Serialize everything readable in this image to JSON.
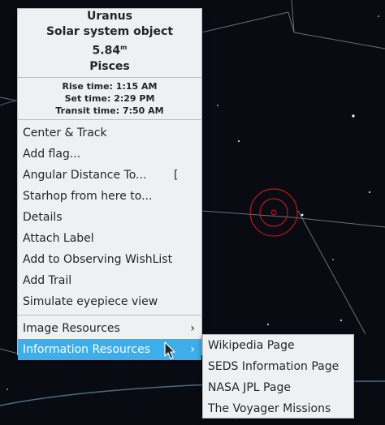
{
  "object": {
    "name": "Uranus",
    "type": "Solar system object",
    "magnitude": "5.84",
    "magnitude_unit": "m",
    "constellation": "Pisces",
    "rise": "Rise time: 1:15 AM",
    "set": "Set time: 2:29 PM",
    "transit": "Transit time: 7:50 AM"
  },
  "menu": {
    "center_track": "Center & Track",
    "add_flag": "Add flag...",
    "angular_distance": "Angular Distance To...",
    "angular_distance_shortcut": "[",
    "starhop": "Starhop from here to...",
    "details": "Details",
    "attach_label": "Attach Label",
    "add_wishlist": "Add to Observing WishList",
    "add_trail": "Add Trail",
    "simulate_eyepiece": "Simulate eyepiece view",
    "image_resources": "Image Resources",
    "information_resources": "Information Resources"
  },
  "submenu": {
    "wikipedia": "Wikipedia Page",
    "seds": "SEDS Information Page",
    "nasa_jpl": "NASA JPL Page",
    "voyager": "The Voyager Missions"
  },
  "icons": {
    "submenu_arrow": "chevron-right-icon",
    "cursor": "mouse-pointer-icon",
    "planet_marker": "target-circle-icon"
  },
  "colors": {
    "menu_bg": "#eff0f1",
    "highlight": "#3daee9",
    "marker": "#c0161b",
    "sky": "#080c12"
  }
}
